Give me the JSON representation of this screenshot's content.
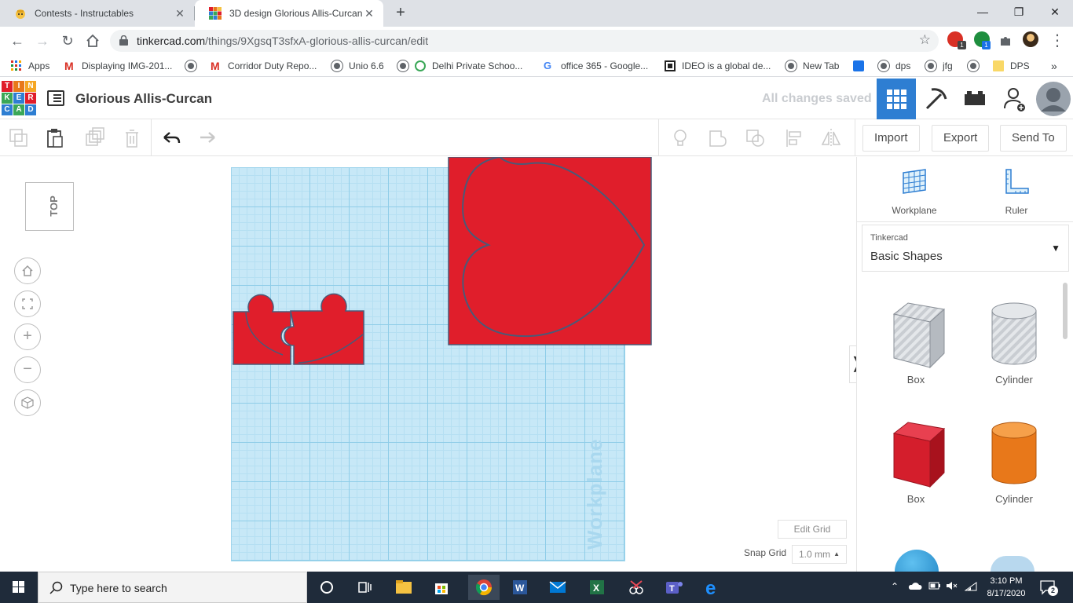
{
  "browser": {
    "tabs": [
      {
        "title": "Contests - Instructables",
        "active": false
      },
      {
        "title": "3D design Glorious Allis-Curcan |",
        "active": true
      }
    ],
    "new_tab": "+",
    "window_controls": {
      "minimize": "—",
      "maximize": "❐",
      "close": "✕"
    },
    "url_host": "tinkercad.com",
    "url_path": "/things/9XgsqT3sfxA-glorious-allis-curcan/edit",
    "extension_badges": [
      "1",
      "1"
    ]
  },
  "bookmarks": [
    {
      "label": "Apps",
      "icon": "apps-grid-icon"
    },
    {
      "label": "Displaying IMG-201...",
      "icon": "gmail-icon"
    },
    {
      "label": "",
      "icon": "globe-icon"
    },
    {
      "label": "Corridor Duty Repo...",
      "icon": "gmail-icon"
    },
    {
      "label": "Unio 6.6",
      "icon": "globe-icon"
    },
    {
      "label": "Delhi Private Schoo...",
      "icon": "school-icon"
    },
    {
      "label": "office 365 - Google...",
      "icon": "google-icon"
    },
    {
      "label": "IDEO is a global de...",
      "icon": "ideo-icon"
    },
    {
      "label": "New Tab",
      "icon": "globe-icon"
    },
    {
      "label": "",
      "icon": "arrow-icon"
    },
    {
      "label": "dps",
      "icon": "globe-icon"
    },
    {
      "label": "jfg",
      "icon": "globe-icon"
    },
    {
      "label": "",
      "icon": "globe-icon"
    },
    {
      "label": "DPS",
      "icon": "folder-icon"
    }
  ],
  "bookmarks_overflow": "»",
  "tinkercad": {
    "logo_letters": [
      "T",
      "I",
      "N",
      "K",
      "E",
      "R",
      "C",
      "A",
      "D"
    ],
    "design_title": "Glorious Allis-Curcan",
    "save_status": "All changes saved",
    "actions": {
      "import": "Import",
      "export": "Export",
      "send_to": "Send To"
    },
    "viewcube_face": "TOP",
    "workplane_label": "Workplane",
    "edit_grid": "Edit Grid",
    "snap_grid_label": "Snap Grid",
    "snap_grid_value": "1.0 mm",
    "collapse_arrow": "❭"
  },
  "panel": {
    "tools": [
      {
        "label": "Workplane",
        "icon": "workplane-icon"
      },
      {
        "label": "Ruler",
        "icon": "ruler-icon"
      }
    ],
    "library_group": "Tinkercad",
    "library_name": "Basic Shapes",
    "shapes": [
      {
        "label": "Box",
        "icon": "box-hole-icon"
      },
      {
        "label": "Cylinder",
        "icon": "cylinder-hole-icon"
      },
      {
        "label": "Box",
        "icon": "box-red-icon"
      },
      {
        "label": "Cylinder",
        "icon": "cylinder-orange-icon"
      }
    ]
  },
  "taskbar": {
    "search_placeholder": "Type here to search",
    "time": "3:10 PM",
    "date": "8/17/2020",
    "notification_count": "2"
  },
  "colors": {
    "tinkercad_red": "#e01e2b",
    "workplane_blue": "#c7e8f7",
    "tinkercad_blue": "#2e7ed2",
    "cylinder_orange": "#e8781a"
  }
}
